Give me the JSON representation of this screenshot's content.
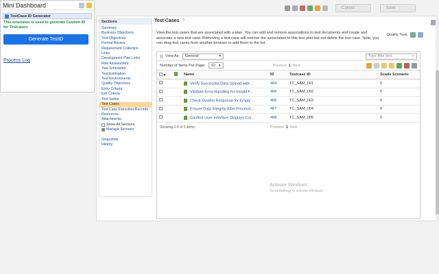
{
  "dashboard": {
    "title": "Mini Dashboard",
    "extension_title": "TestCase ID Generator",
    "extension_desc": "This extension is used to generate Custom ID for Testcases.",
    "generate_button": "Generate TestID",
    "process_log": "Process Log"
  },
  "toolbar": {
    "cancel": "Cancel",
    "save": "Save"
  },
  "sections": {
    "header": "Sections",
    "items": [
      "Summary",
      "Business Objectives",
      "Test Objectives",
      "Formal Review",
      "Requirement Collection",
      "Development Plan Links",
      "Risk Assessment",
      "Test Schedules",
      "Test Estimation",
      "Test Environments",
      "Quality Objectives",
      "Entry Criteria",
      "Exit Criteria",
      "Test Suites",
      "Test Cases",
      "Test Case Execution Records",
      "Resources",
      "Attachments"
    ],
    "req_links_cont": "Links",
    "show_all": "Show All Sections",
    "manage": "Manage Sections",
    "snapshots": "Snapshots",
    "history": "History"
  },
  "content": {
    "title": "Test Cases",
    "description": "View the test cases that are associated with a plan. You can add and remove associations to test documents and create and associate a new test case. Removing a test case will remove the association to this test plan but not delete the test case. Note, you can drag test cases from another browser to add them to the list.",
    "quality_task": "Quality Task:",
    "view_as_label": "View As:",
    "view_as_value": "General",
    "filter_placeholder": "Type filter text",
    "items_per_page_label": "Number of Items Per Page:",
    "items_per_page_value": "10",
    "previous": "Previous",
    "page": "1",
    "next": "Next",
    "columns": {
      "name": "Name",
      "id": "ID",
      "testcase_id": "Testcase ID",
      "scade": "Scade Scenario"
    },
    "rows": [
      {
        "name": "Verify Successful Data Upload with ...",
        "id": "464",
        "tcid": "TC_SAM_001",
        "scade": "0"
      },
      {
        "name": "Validate Error Handling for Invalid F...",
        "id": "465",
        "tcid": "TC_SAM_002",
        "scade": "0"
      },
      {
        "name": "Check System Response for Empty ...",
        "id": "466",
        "tcid": "TC_SAM_003",
        "scade": "0"
      },
      {
        "name": "Ensure Data Integrity After Processi...",
        "id": "467",
        "tcid": "TC_SAM_004",
        "scade": "0"
      },
      {
        "name": "Confirm User Interface Displays Cor...",
        "id": "468",
        "tcid": "TC_SAM_005",
        "scade": "0"
      }
    ],
    "showing": "Showing 1-5 of 5 items"
  },
  "watermark": {
    "line1": "Activate Windows",
    "line2": "Go to Settings to activate Windows."
  }
}
